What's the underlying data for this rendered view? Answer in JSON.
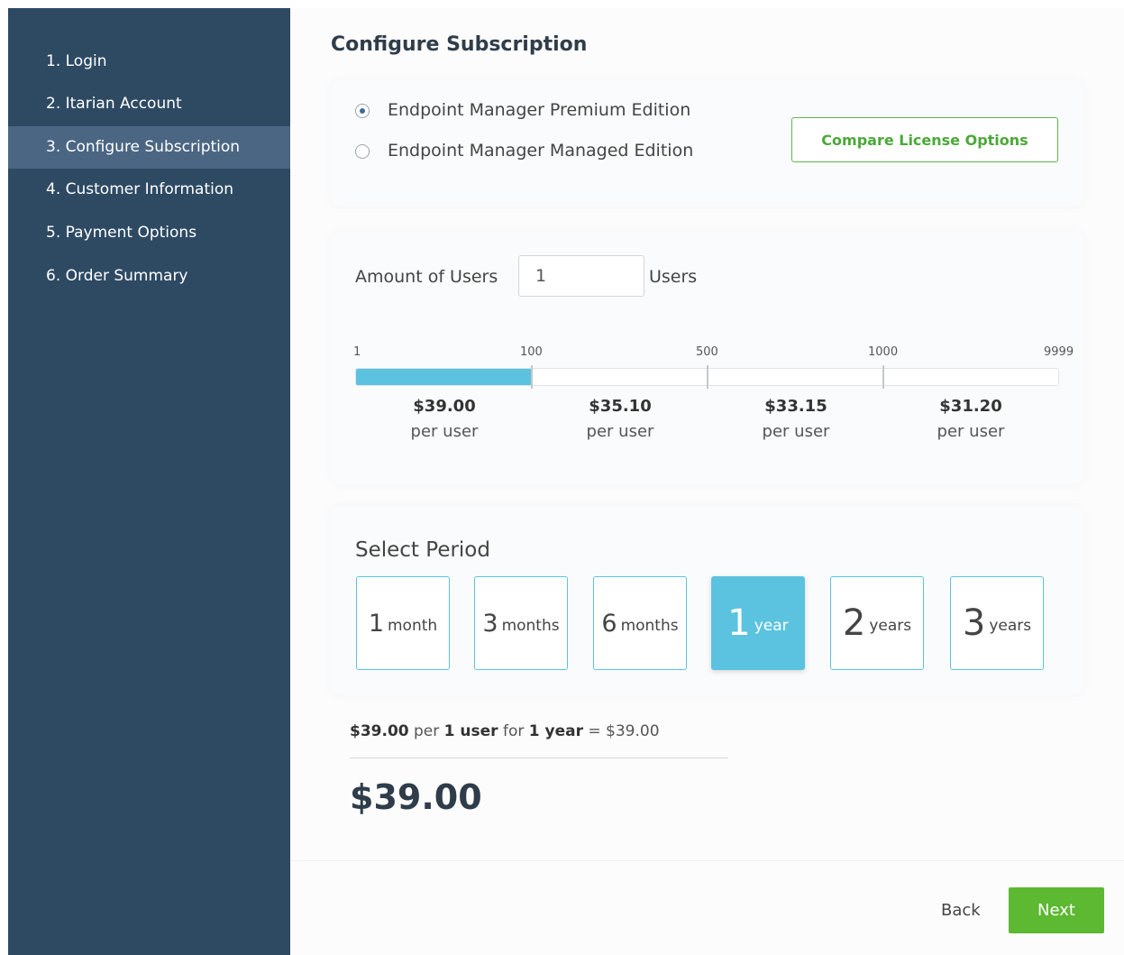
{
  "sidebar": {
    "steps": [
      {
        "label": "1. Login"
      },
      {
        "label": "2. Itarian Account"
      },
      {
        "label": "3. Configure Subscription",
        "active": true
      },
      {
        "label": "4. Customer Information"
      },
      {
        "label": "5. Payment Options"
      },
      {
        "label": "6. Order Summary"
      }
    ]
  },
  "main": {
    "title": "Configure Subscription",
    "editions": [
      {
        "label": "Endpoint Manager Premium Edition",
        "checked": true
      },
      {
        "label": "Endpoint Manager Managed Edition",
        "checked": false
      }
    ],
    "compare_button": "Compare License Options",
    "users": {
      "label": "Amount of Users",
      "value": "1",
      "unit": "Users"
    },
    "slider": {
      "ticks": [
        "1",
        "100",
        "500",
        "1000",
        "9999"
      ],
      "fill_fraction": 0.25,
      "tiers": [
        {
          "price": "$39.00",
          "per": "per user"
        },
        {
          "price": "$35.10",
          "per": "per user"
        },
        {
          "price": "$33.15",
          "per": "per user"
        },
        {
          "price": "$31.20",
          "per": "per user"
        }
      ]
    },
    "period": {
      "title": "Select Period",
      "options": [
        {
          "num": "1",
          "unit": "month"
        },
        {
          "num": "3",
          "unit": "months"
        },
        {
          "num": "6",
          "unit": "months"
        },
        {
          "num": "1",
          "unit": "year",
          "selected": true
        },
        {
          "num": "2",
          "unit": "years"
        },
        {
          "num": "3",
          "unit": "years"
        }
      ]
    },
    "calculation": {
      "price": "$39.00",
      "per_text": "per",
      "users_text": "1 user",
      "for_text": "for",
      "period_text": "1 year",
      "equals_text": "= $39.00"
    },
    "total": "$39.00"
  },
  "footer": {
    "back_label": "Back",
    "next_label": "Next"
  },
  "colors": {
    "sidebar_bg": "#2e4a63",
    "sidebar_active": "#4a6683",
    "accent_blue": "#5bc3e0",
    "accent_green": "#5db832"
  }
}
